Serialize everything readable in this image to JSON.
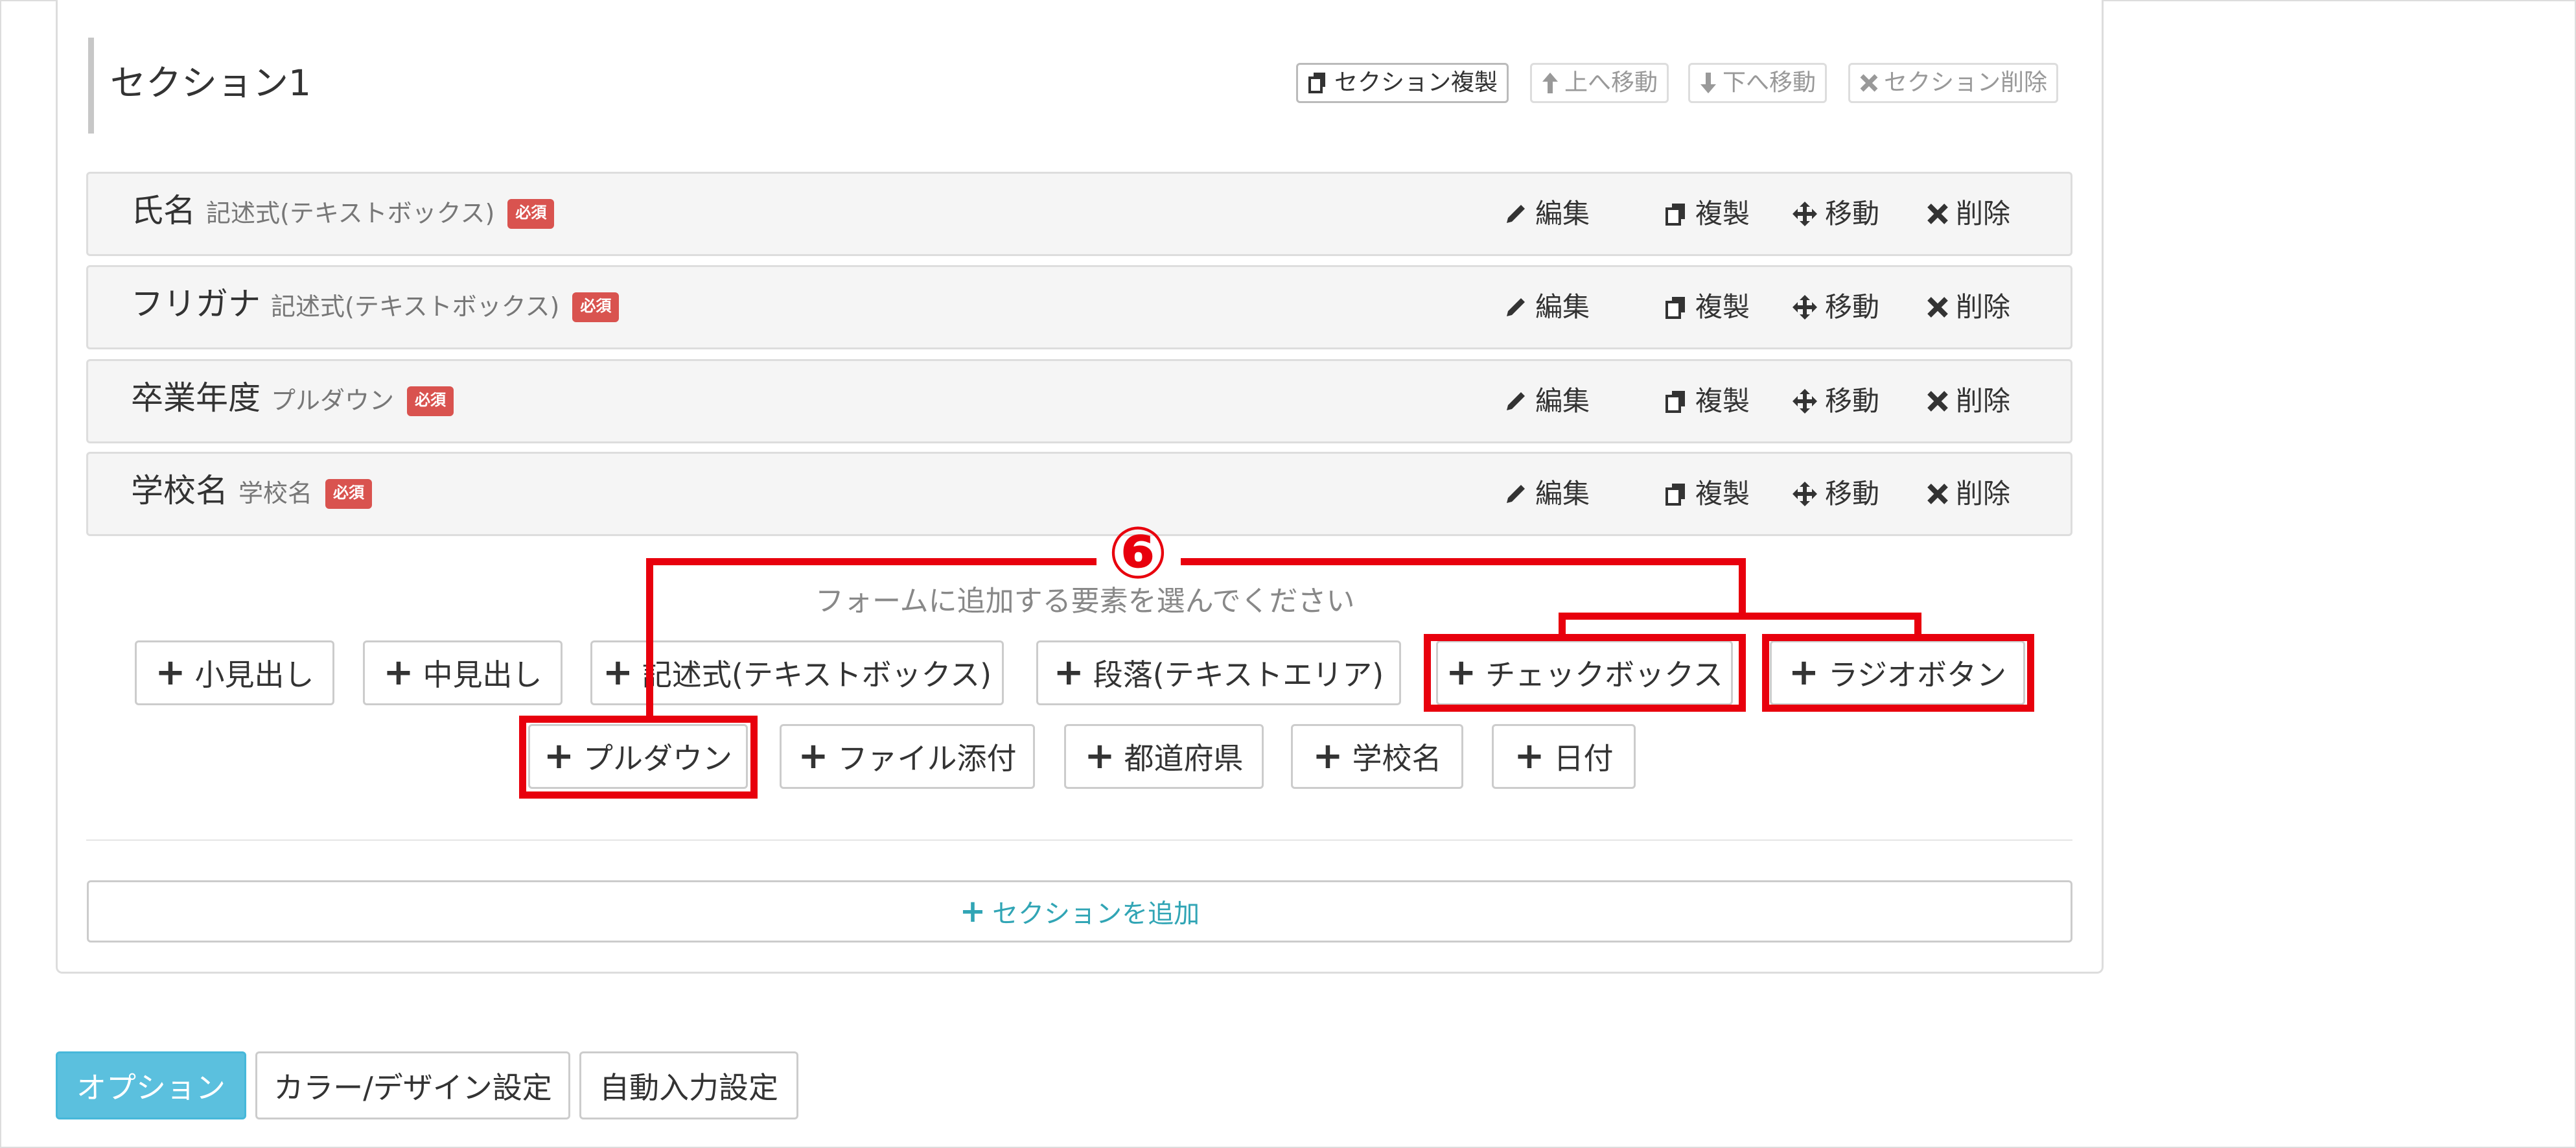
{
  "section": {
    "title": "セクション1",
    "buttons": [
      {
        "label": "セクション複製",
        "icon": "copy-icon",
        "enabled": true
      },
      {
        "label": "上へ移動",
        "icon": "arrow-up-icon",
        "enabled": false
      },
      {
        "label": "下へ移動",
        "icon": "arrow-down-icon",
        "enabled": false
      },
      {
        "label": "セクション削除",
        "icon": "close-icon",
        "enabled": false
      }
    ]
  },
  "fields": [
    {
      "name": "氏名",
      "type": "記述式(テキストボックス)",
      "badge": "必須"
    },
    {
      "name": "フリガナ",
      "type": "記述式(テキストボックス)",
      "badge": "必須"
    },
    {
      "name": "卒業年度",
      "type": "プルダウン",
      "badge": "必須"
    },
    {
      "name": "学校名",
      "type": "学校名",
      "badge": "必須"
    }
  ],
  "row_actions": {
    "edit": "編集",
    "copy": "複製",
    "move": "移動",
    "delete": "削除"
  },
  "annotation": {
    "number": "⑥"
  },
  "element_picker": {
    "prompt": "フォームに追加する要素を選んでください",
    "row1": [
      "小見出し",
      "中見出し",
      "記述式(テキストボックス)",
      "段落(テキストエリア)",
      "チェックボックス",
      "ラジオボタン"
    ],
    "row2": [
      "プルダウン",
      "ファイル添付",
      "都道府県",
      "学校名",
      "日付"
    ]
  },
  "add_section": {
    "label": "セクションを追加"
  },
  "tabs": [
    "オプション",
    "カラー/デザイン設定",
    "自動入力設定"
  ],
  "colors": {
    "highlight": "#e8000d",
    "badge": "#d9534f",
    "active_tab": "#5bc0de",
    "link": "#31a5b5"
  }
}
